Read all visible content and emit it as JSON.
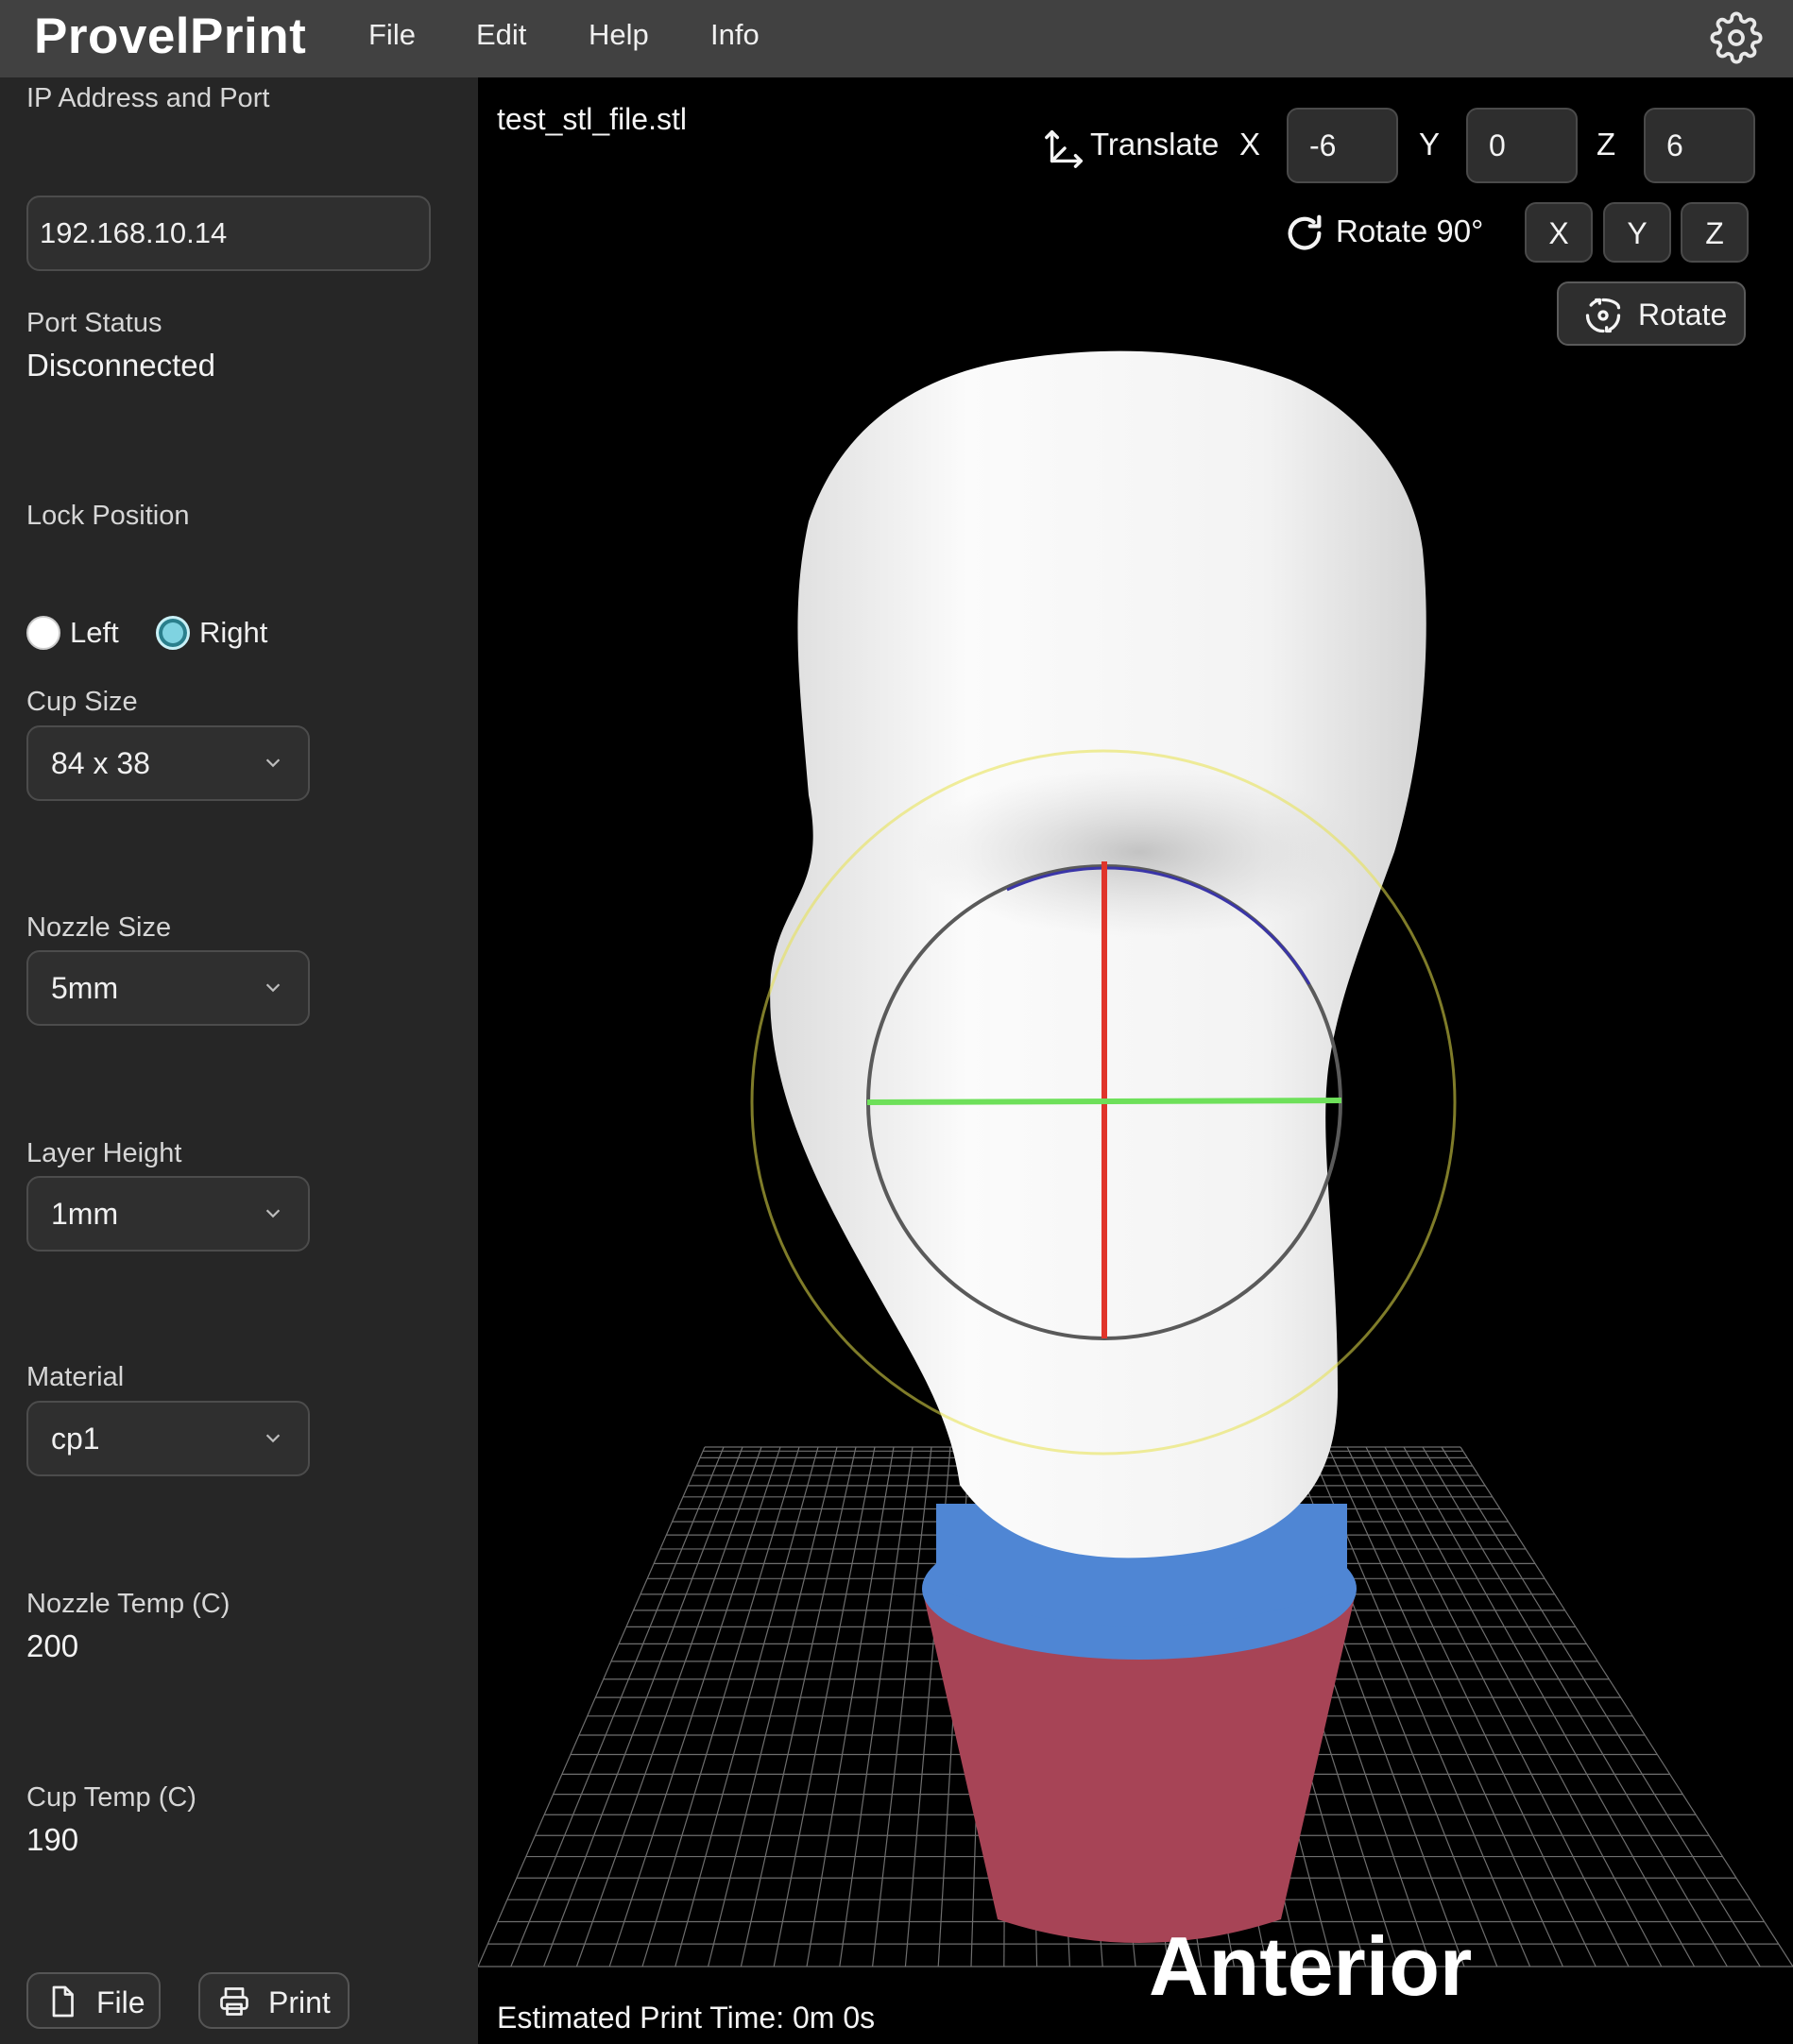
{
  "app": {
    "brand": "ProvelPrint"
  },
  "menu": {
    "file": "File",
    "edit": "Edit",
    "help": "Help",
    "info": "Info"
  },
  "sidebar": {
    "ip_label": "IP Address and Port",
    "ip_value": "192.168.10.14",
    "port_status_label": "Port Status",
    "port_status_value": "Disconnected",
    "lock_label": "Lock Position",
    "lock_left": "Left",
    "lock_right": "Right",
    "lock_selected": "Right",
    "cup_label": "Cup Size",
    "cup_value": "84 x 38",
    "nozzle_label": "Nozzle Size",
    "nozzle_value": "5mm",
    "layer_label": "Layer Height",
    "layer_value": "1mm",
    "material_label": "Material",
    "material_value": "cp1",
    "nozzle_temp_label": "Nozzle Temp (C)",
    "nozzle_temp_value": "200",
    "cup_temp_label": "Cup Temp (C)",
    "cup_temp_value": "190",
    "file_button": "File",
    "print_button": "Print"
  },
  "viewport": {
    "filename": "test_stl_file.stl",
    "translate_label": "Translate",
    "x_label": "X",
    "y_label": "Y",
    "z_label": "Z",
    "translate_x": "-6",
    "translate_y": "0",
    "translate_z": "6",
    "rotate90_label": "Rotate 90°",
    "rot_x": "X",
    "rot_y": "Y",
    "rot_z": "Z",
    "rotate_button": "Rotate",
    "view_label": "Anterior",
    "estimate": "Estimated Print Time: 0m 0s"
  },
  "colors": {
    "accent_radio": "#7fd3e1",
    "model": "#f2f2f2",
    "cup_blue": "#4f86d4",
    "cup_red": "#a74456",
    "axis_red": "#e0352b",
    "axis_green": "#6ee05a"
  }
}
